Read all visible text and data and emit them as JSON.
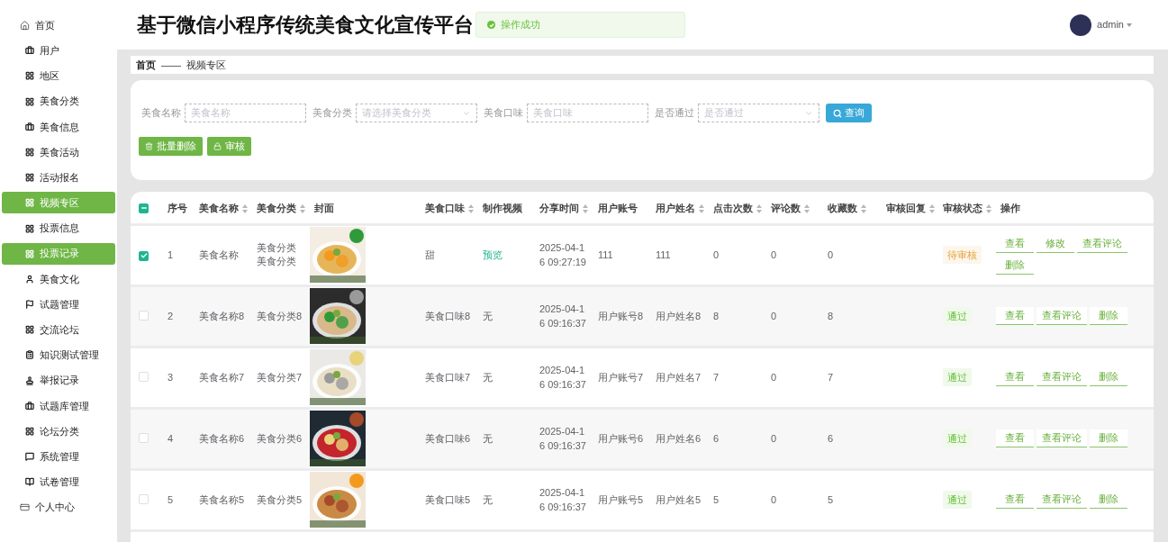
{
  "sidebar": {
    "items": [
      {
        "label": "首页",
        "kind": "section",
        "highlighted": false
      },
      {
        "label": "用户",
        "kind": "item",
        "highlighted": false
      },
      {
        "label": "地区",
        "kind": "item",
        "highlighted": false
      },
      {
        "label": "美食分类",
        "kind": "item",
        "highlighted": false
      },
      {
        "label": "美食信息",
        "kind": "item",
        "highlighted": false
      },
      {
        "label": "美食活动",
        "kind": "item",
        "highlighted": false
      },
      {
        "label": "活动报名",
        "kind": "item",
        "highlighted": false
      },
      {
        "label": "视频专区",
        "kind": "item",
        "highlighted": true
      },
      {
        "label": "投票信息",
        "kind": "item",
        "highlighted": false
      },
      {
        "label": "投票记录",
        "kind": "item",
        "highlighted": true
      },
      {
        "label": "美食文化",
        "kind": "item",
        "highlighted": false
      },
      {
        "label": "试题管理",
        "kind": "item",
        "highlighted": false
      },
      {
        "label": "交流论坛",
        "kind": "item",
        "highlighted": false
      },
      {
        "label": "知识测试管理",
        "kind": "item",
        "highlighted": false
      },
      {
        "label": "举报记录",
        "kind": "item",
        "highlighted": false
      },
      {
        "label": "试题库管理",
        "kind": "item",
        "highlighted": false
      },
      {
        "label": "论坛分类",
        "kind": "item",
        "highlighted": false
      },
      {
        "label": "系统管理",
        "kind": "item",
        "highlighted": false
      },
      {
        "label": "试卷管理",
        "kind": "item",
        "highlighted": false
      },
      {
        "label": "个人中心",
        "kind": "section",
        "highlighted": false
      }
    ]
  },
  "header": {
    "title": "基于微信小程序传统美食文化宣传平台",
    "toast": "操作成功",
    "user": "admin"
  },
  "breadcrumb": {
    "home": "首页",
    "separator": "——",
    "current": "视频专区"
  },
  "search": {
    "fields": [
      {
        "label": "美食名称",
        "placeholder": "美食名称",
        "kind": "input"
      },
      {
        "label": "美食分类",
        "placeholder": "请选择美食分类",
        "kind": "select"
      },
      {
        "label": "美食口味",
        "placeholder": "美食口味",
        "kind": "input"
      },
      {
        "label": "是否通过",
        "placeholder": "是否通过",
        "kind": "select"
      }
    ],
    "query_button": "查询",
    "batch_delete_button": "批量删除",
    "review_button": "审核"
  },
  "table": {
    "header_checkbox": {
      "indeterminate": true
    },
    "columns": [
      {
        "label": "序号",
        "sortable": false
      },
      {
        "label": "美食名称",
        "sortable": true
      },
      {
        "label": "美食分类",
        "sortable": true
      },
      {
        "label": "封面",
        "sortable": false
      },
      {
        "label": "美食口味",
        "sortable": true
      },
      {
        "label": "制作视频",
        "sortable": false
      },
      {
        "label": "分享时间",
        "sortable": true
      },
      {
        "label": "用户账号",
        "sortable": false
      },
      {
        "label": "用户姓名",
        "sortable": true
      },
      {
        "label": "点击次数",
        "sortable": true
      },
      {
        "label": "评论数",
        "sortable": true
      },
      {
        "label": "收藏数",
        "sortable": true
      },
      {
        "label": "审核回复",
        "sortable": true
      },
      {
        "label": "审核状态",
        "sortable": true
      },
      {
        "label": "操作",
        "sortable": false
      }
    ],
    "rows": [
      {
        "checked": true,
        "index": "1",
        "name": "美食名称",
        "category": "美食分类美食分类",
        "cover": {
          "kind": "picture"
        },
        "taste": "甜",
        "video": {
          "text": "预览",
          "kind": "link"
        },
        "time": "2025-04-16 09:27:19",
        "account": "111",
        "username": "111",
        "clicks": "0",
        "comments": "0",
        "favorites": "0",
        "status": {
          "text": "待审核",
          "kind": "pending"
        },
        "actions": [
          "查看",
          "修改",
          "查看评论",
          "删除"
        ]
      },
      {
        "checked": false,
        "index": "2",
        "name": "美食名称8",
        "category": "美食分类8",
        "cover": {
          "kind": "picture"
        },
        "taste": "美食口味8",
        "video": {
          "text": "无",
          "kind": "text"
        },
        "time": "2025-04-16 09:16:37",
        "account": "用户账号8",
        "username": "用户姓名8",
        "clicks": "8",
        "comments": "0",
        "favorites": "8",
        "status": {
          "text": "通过",
          "kind": "passed"
        },
        "actions": [
          "查看",
          "查看评论",
          "删除"
        ]
      },
      {
        "checked": false,
        "index": "3",
        "name": "美食名称7",
        "category": "美食分类7",
        "cover": {
          "kind": "picture"
        },
        "taste": "美食口味7",
        "video": {
          "text": "无",
          "kind": "text"
        },
        "time": "2025-04-16 09:16:37",
        "account": "用户账号7",
        "username": "用户姓名7",
        "clicks": "7",
        "comments": "0",
        "favorites": "7",
        "status": {
          "text": "通过",
          "kind": "passed"
        },
        "actions": [
          "查看",
          "查看评论",
          "删除"
        ]
      },
      {
        "checked": false,
        "index": "4",
        "name": "美食名称6",
        "category": "美食分类6",
        "cover": {
          "kind": "picture"
        },
        "taste": "美食口味6",
        "video": {
          "text": "无",
          "kind": "text"
        },
        "time": "2025-04-16 09:16:37",
        "account": "用户账号6",
        "username": "用户姓名6",
        "clicks": "6",
        "comments": "0",
        "favorites": "6",
        "status": {
          "text": "通过",
          "kind": "passed"
        },
        "actions": [
          "查看",
          "查看评论",
          "删除"
        ]
      },
      {
        "checked": false,
        "index": "5",
        "name": "美食名称5",
        "category": "美食分类5",
        "cover": {
          "kind": "picture"
        },
        "taste": "美食口味5",
        "video": {
          "text": "无",
          "kind": "text"
        },
        "time": "2025-04-16 09:16:37",
        "account": "用户账号5",
        "username": "用户姓名5",
        "clicks": "5",
        "comments": "0",
        "favorites": "5",
        "status": {
          "text": "通过",
          "kind": "passed"
        },
        "actions": [
          "查看",
          "查看评论",
          "删除"
        ]
      }
    ]
  }
}
